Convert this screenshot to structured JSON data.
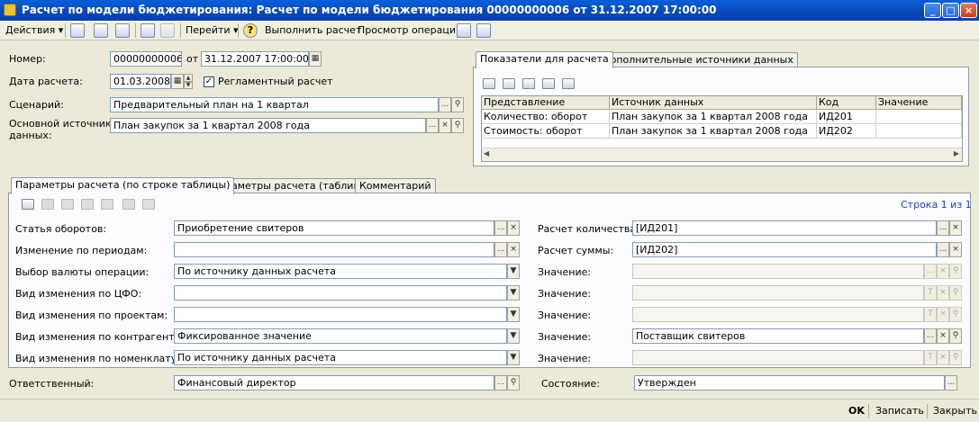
{
  "window": {
    "title": "Расчет по модели бюджетирования: Расчет по модели бюджетирования 00000000006 от 31.12.2007 17:00:00",
    "min": "_",
    "max": "□",
    "close": "×"
  },
  "toolbar": {
    "actions": "Действия",
    "goto": "Перейти",
    "help": "?",
    "run": "Выполнить расчет",
    "view_ops": "Просмотр операций"
  },
  "header": {
    "number_label": "Номер:",
    "number_value": "00000000006",
    "from_label": "от",
    "date_value": "31.12.2007 17:00:00",
    "calc_date_label": "Дата расчета:",
    "calc_date_value": "01.03.2008",
    "reglament_label": "Регламентный расчет",
    "reglament_checked": "✓",
    "scenario_label": "Сценарий:",
    "scenario_value": "Предварительный план на 1 квартал",
    "source_label_1": "Основной источник",
    "source_label_2": "данных:",
    "source_value": "План закупок за 1 квартал 2008 года"
  },
  "indicators": {
    "tab_main": "Показатели для расчета",
    "tab_extra": "Дополнительные источники данных",
    "columns": [
      "Представление",
      "Источник данных",
      "Код",
      "Значение"
    ],
    "rows": [
      [
        "Количество: оборот",
        "План закупок за 1 квартал 2008 года",
        "ИД201",
        ""
      ],
      [
        "Стоимость: оборот",
        "План закупок за 1 квартал 2008 года",
        "ИД202",
        ""
      ]
    ]
  },
  "params": {
    "tab1": "Параметры расчета (по строке таблицы)",
    "tab2": "Параметры расчета (таблица)",
    "tab3": "Комментарий",
    "row_counter": "Строка 1 из 1",
    "left": [
      {
        "label": "Статья оборотов:",
        "value": "Приобретение свитеров"
      },
      {
        "label": "Изменение по периодам:",
        "value": ""
      },
      {
        "label": "Выбор валюты операции:",
        "value": "По источнику данных расчета"
      },
      {
        "label": "Вид изменения по ЦФО:",
        "value": ""
      },
      {
        "label": "Вид изменения по проектам:",
        "value": ""
      },
      {
        "label": "Вид изменения по контрагентам:",
        "value": "Фиксированное значение"
      },
      {
        "label": "Вид изменения по номенклатуре:",
        "value": "По источнику данных расчета"
      }
    ],
    "right": [
      {
        "label": "Расчет количества:",
        "value": "[ИД201]"
      },
      {
        "label": "Расчет суммы:",
        "value": "[ИД202]"
      },
      {
        "label": "Значение:",
        "value": ""
      },
      {
        "label": "Значение:",
        "value": ""
      },
      {
        "label": "Значение:",
        "value": ""
      },
      {
        "label": "Значение:",
        "value": "Поставщик свитеров"
      },
      {
        "label": "Значение:",
        "value": ""
      }
    ]
  },
  "footer": {
    "responsible_label": "Ответственный:",
    "responsible_value": "Финансовый директор",
    "state_label": "Состояние:",
    "state_value": "Утвержден"
  },
  "buttons": {
    "ok": "OK",
    "save": "Записать",
    "close": "Закрыть"
  },
  "glyphs": {
    "dots": "...",
    "x": "×",
    "search": "⚲",
    "dropdown": "▼",
    "calendar": "▦",
    "t": "T",
    "up": "▲",
    "down": "▼",
    "left": "◀",
    "right": "▶"
  }
}
